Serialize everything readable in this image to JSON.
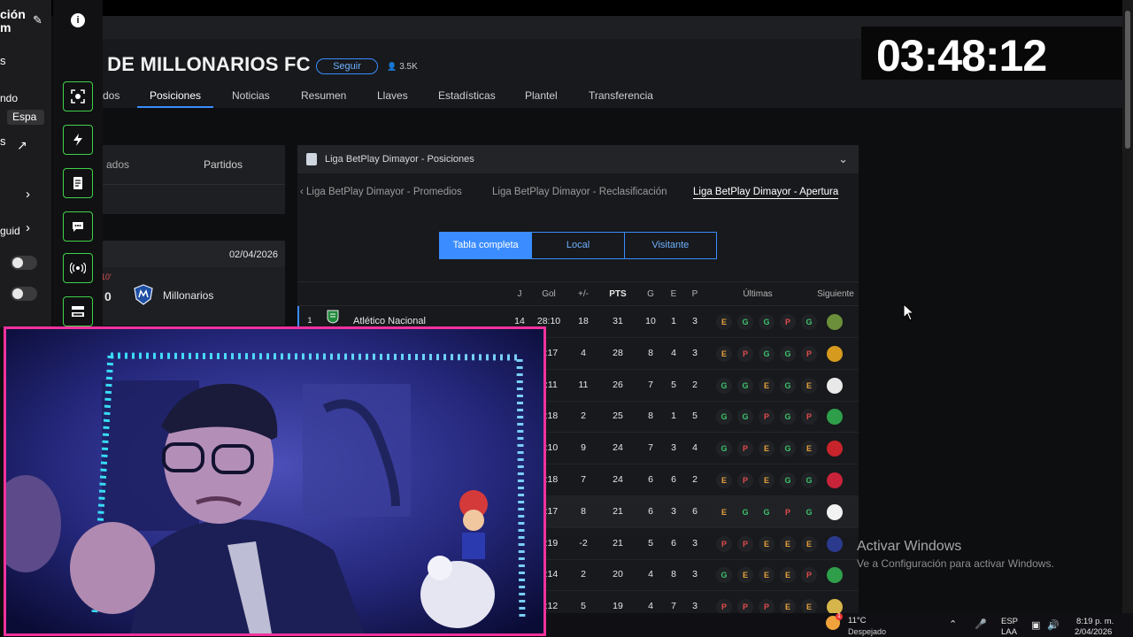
{
  "header": {
    "team_title": "S DE MILLONARIOS FC",
    "follow_label": "Seguir",
    "followers": "3.5K"
  },
  "nav": {
    "tabs": [
      "dos",
      "Posiciones",
      "Noticias",
      "Resumen",
      "Llaves",
      "Estadísticas",
      "Plantel",
      "Transferencia"
    ]
  },
  "left_card": {
    "tab1": "ados",
    "tab2": "Partidos"
  },
  "match": {
    "date": "02/04/2026",
    "minute": "10'",
    "score": "0",
    "team": "Millonarios"
  },
  "standings": {
    "title": "Liga BetPlay Dimayor - Posiciones",
    "subtabs": [
      "Liga BetPlay Dimayor - Promedios",
      "Liga BetPlay Dimayor - Reclasificación",
      "Liga BetPlay Dimayor - Apertura"
    ],
    "segments": [
      "Tabla completa",
      "Local",
      "Visitante"
    ],
    "columns": [
      "J",
      "Gol",
      "+/-",
      "PTS",
      "G",
      "E",
      "P",
      "Últimas",
      "Siguiente"
    ],
    "rows": [
      {
        "pos": "1",
        "team": "Atlético Nacional",
        "j": "14",
        "gol": "28:10",
        "diff": "18",
        "pts": "31",
        "g": "10",
        "e": "1",
        "p": "3",
        "form": [
          "E",
          "G",
          "G",
          "P",
          "G"
        ],
        "next_color": "#6b8f3a"
      },
      {
        "pos": "",
        "team": "",
        "j": "",
        "gol": "1:17",
        "diff": "4",
        "pts": "28",
        "g": "8",
        "e": "4",
        "p": "3",
        "form": [
          "E",
          "P",
          "G",
          "G",
          "P"
        ],
        "next_color": "#d69a1e"
      },
      {
        "pos": "",
        "team": "",
        "j": "",
        "gol": "2:11",
        "diff": "11",
        "pts": "26",
        "g": "7",
        "e": "5",
        "p": "2",
        "form": [
          "G",
          "G",
          "E",
          "G",
          "E"
        ],
        "next_color": "#e8e8e8"
      },
      {
        "pos": "",
        "team": "",
        "j": "",
        "gol": "0:18",
        "diff": "2",
        "pts": "25",
        "g": "8",
        "e": "1",
        "p": "5",
        "form": [
          "G",
          "G",
          "P",
          "G",
          "P"
        ],
        "next_color": "#2e9e4a"
      },
      {
        "pos": "",
        "team": "",
        "j": "",
        "gol": "2:10",
        "diff": "9",
        "pts": "24",
        "g": "7",
        "e": "3",
        "p": "4",
        "form": [
          "G",
          "P",
          "E",
          "G",
          "E"
        ],
        "next_color": "#c7242b"
      },
      {
        "pos": "",
        "team": "",
        "j": "",
        "gol": "5:18",
        "diff": "7",
        "pts": "24",
        "g": "6",
        "e": "6",
        "p": "2",
        "form": [
          "E",
          "P",
          "E",
          "G",
          "G"
        ],
        "next_color": "#c8233a"
      },
      {
        "pos": "",
        "team": "",
        "j": "",
        "gol": "5:17",
        "diff": "8",
        "pts": "21",
        "g": "6",
        "e": "3",
        "p": "6",
        "form": [
          "E",
          "G",
          "G",
          "P",
          "G"
        ],
        "next_color": "#f2f2f2"
      },
      {
        "pos": "",
        "team": "",
        "j": "",
        "gol": "7:19",
        "diff": "-2",
        "pts": "21",
        "g": "5",
        "e": "6",
        "p": "3",
        "form": [
          "P",
          "P",
          "E",
          "E",
          "E"
        ],
        "next_color": "#2b3a8c"
      },
      {
        "pos": "",
        "team": "",
        "j": "",
        "gol": "6:14",
        "diff": "2",
        "pts": "20",
        "g": "4",
        "e": "8",
        "p": "3",
        "form": [
          "G",
          "E",
          "E",
          "E",
          "P"
        ],
        "next_color": "#2e9e4a"
      },
      {
        "pos": "",
        "team": "",
        "j": "",
        "gol": "2:12",
        "diff": "5",
        "pts": "19",
        "g": "4",
        "e": "7",
        "p": "3",
        "form": [
          "P",
          "P",
          "P",
          "E",
          "E"
        ],
        "next_color": "#d6b64a"
      }
    ]
  },
  "timer": "03:48:12",
  "watermark": {
    "line1": "Activar Windows",
    "line2": "Ve a Configuración para activar Windows."
  },
  "overlay": {
    "title1": "ción",
    "title2": "m",
    "item_s": "s",
    "label_ndo": "ndo",
    "lang_pill": "Espa",
    "item_s2": "s",
    "item_guid": "guid"
  },
  "taskbar": {
    "weather_temp": "11°C",
    "weather_desc": "Despejado",
    "lang1": "ESP",
    "lang2": "LAA",
    "time": "8:19 p. m.",
    "date": "2/04/2026"
  }
}
